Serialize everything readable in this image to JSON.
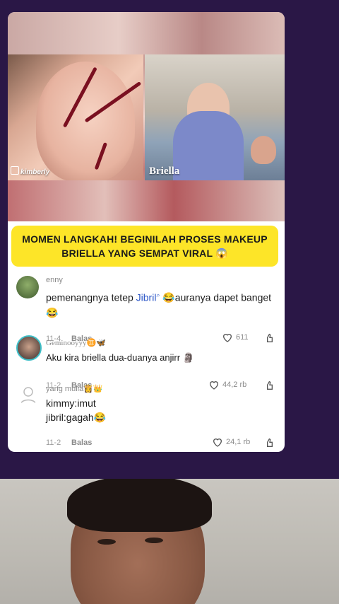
{
  "post": {
    "labels": {
      "left": "kimberly",
      "right": "Briella"
    },
    "headline": "MOMEN LANGKAH! BEGINILAH PROSES MAKEUP BRIELLA YANG SEMPAT VIRAL 😱"
  },
  "comments": [
    {
      "username": "enny",
      "text_before": "pemenangnya tetep ",
      "mention": "Jibril",
      "mention_icon": "search-sparkle-icon",
      "text_after": " 😂auranya dapet banget 😂",
      "date": "11-4",
      "reply_label": "Balas",
      "likes": "611"
    },
    {
      "username": "Geminooyyy♊🦋",
      "text": "Aku kira briella dua-duanya anjirr 🗿",
      "date": "11-2",
      "reply_label": "Balas",
      "likes": "44,2 rb"
    },
    {
      "username": "yang mulia👸👑",
      "text_line1": "kimmy:imut",
      "text_line2": "jibril:gagah😂",
      "date": "11-2",
      "reply_label": "Balas",
      "likes": "24,1 rb"
    }
  ],
  "colors": {
    "background": "#2a1746",
    "headline_bg": "#fde528",
    "mention": "#2a55c6"
  }
}
